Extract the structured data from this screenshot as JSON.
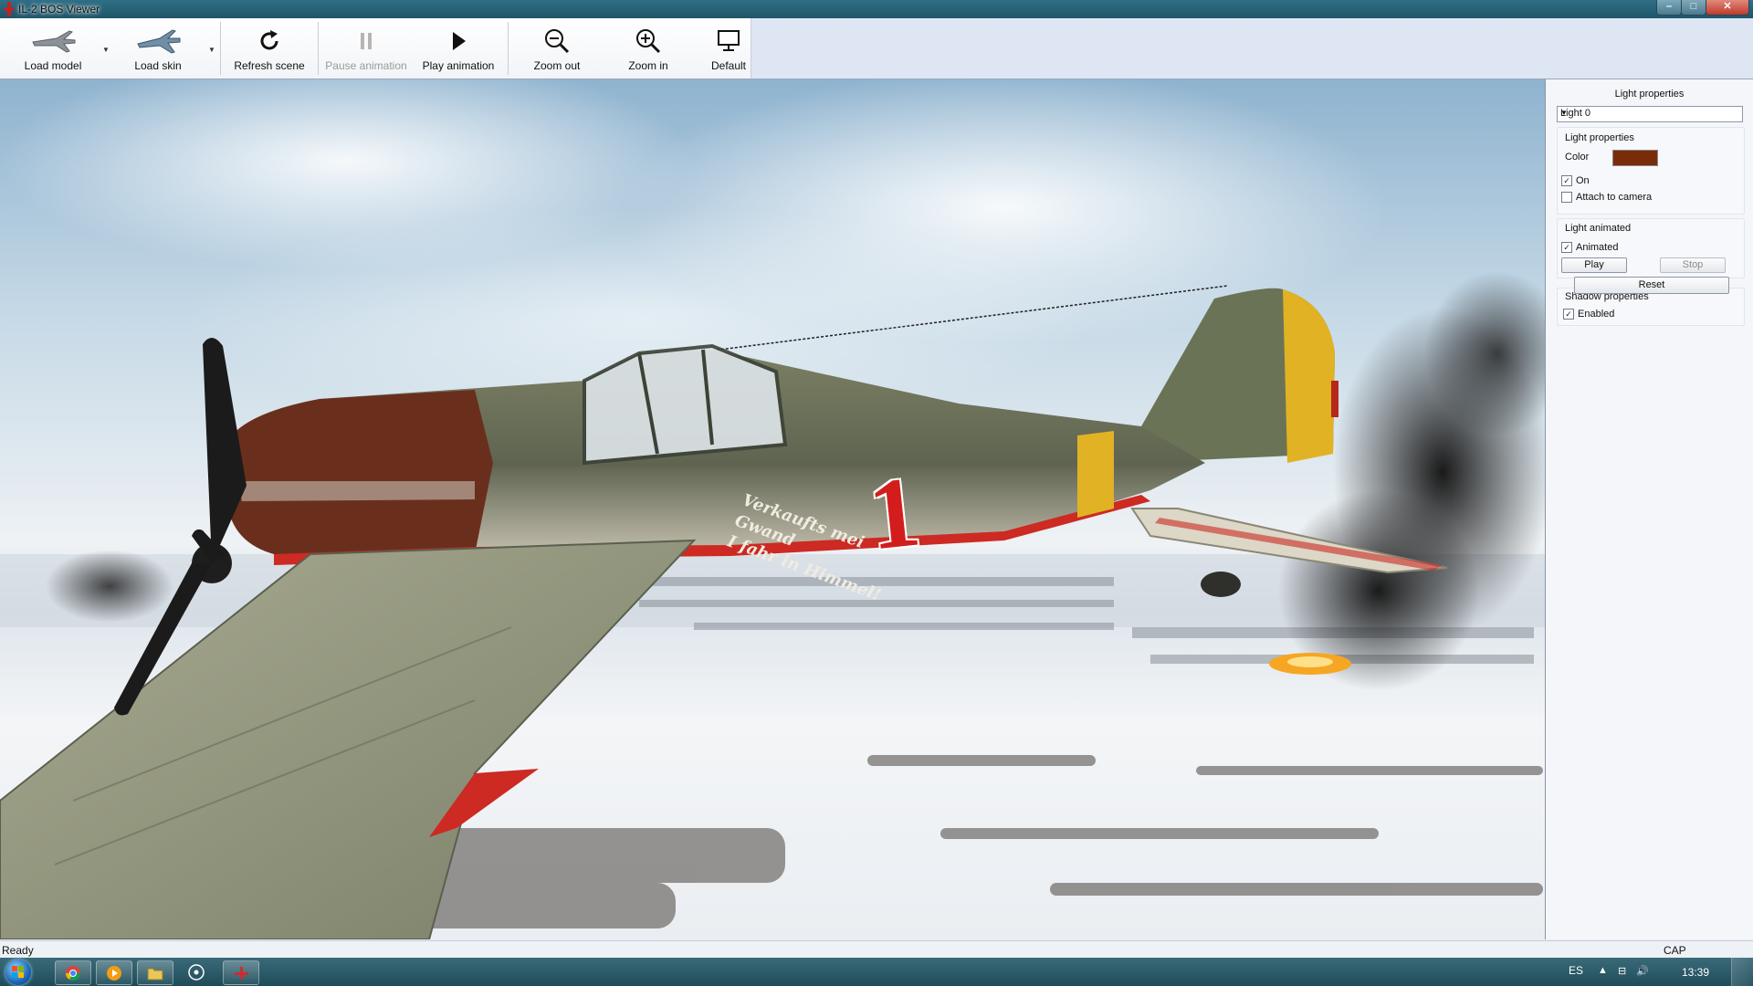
{
  "window": {
    "title": "IL-2 BOS Viewer",
    "minimize_glyph": "–",
    "maximize_glyph": "□",
    "close_glyph": "✕"
  },
  "toolbar": {
    "load_model": "Load model",
    "load_skin": "Load skin",
    "refresh_scene": "Refresh scene",
    "pause_animation": "Pause animation",
    "play_animation": "Play animation",
    "zoom_out": "Zoom out",
    "zoom_in": "Zoom in",
    "default": "Default"
  },
  "viewport": {
    "aircraft_number": "1",
    "fuselage_script_line1": "Verkaufts mei Gwand",
    "fuselage_script_line2": "I fahr in Himmel!"
  },
  "panel": {
    "title": "Light properties",
    "light_select": "Light 0",
    "light_props_group": "Light properties",
    "color_label": "Color",
    "light_color": "#7a2c08",
    "on_label": "On",
    "on_checked": true,
    "attach_label": "Attach to camera",
    "attach_checked": false,
    "animated_group": "Light animated",
    "animated_label": "Animated",
    "animated_checked": true,
    "play": "Play",
    "stop": "Stop",
    "shadow_group": "Shadow properties",
    "enabled_label": "Enabled",
    "enabled_checked": true,
    "reset": "Reset"
  },
  "status": {
    "text": "Ready",
    "caps": "CAP"
  },
  "taskbar": {
    "lang": "ES",
    "clock": "13:39"
  }
}
